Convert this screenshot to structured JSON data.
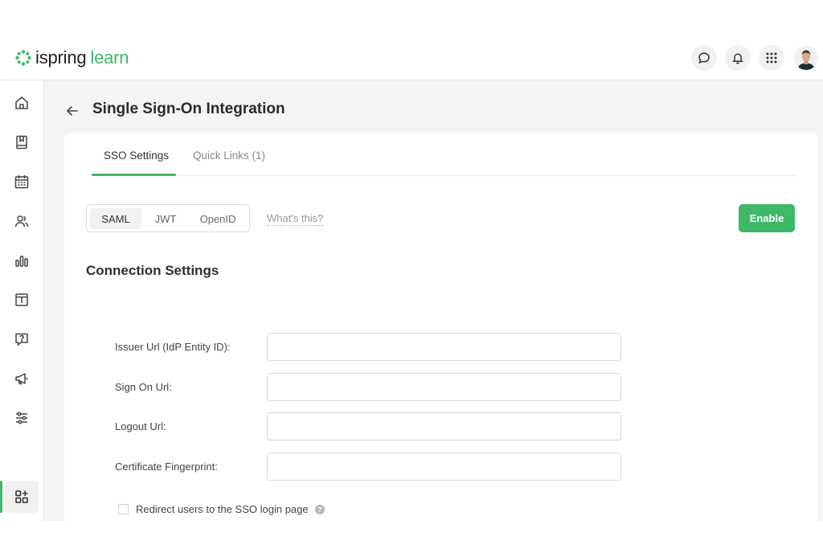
{
  "header": {
    "logo_brand": "ispring",
    "logo_product": "learn",
    "icons": [
      "chat-icon",
      "bell-icon",
      "apps-grid-icon",
      "user-avatar"
    ]
  },
  "sidebar": {
    "items": [
      {
        "name": "home-icon"
      },
      {
        "name": "book-icon"
      },
      {
        "name": "calendar-icon"
      },
      {
        "name": "users-icon"
      },
      {
        "name": "reports-icon"
      },
      {
        "name": "info-box-icon"
      },
      {
        "name": "question-icon"
      },
      {
        "name": "megaphone-icon"
      },
      {
        "name": "settings-sliders-icon"
      },
      {
        "name": "apps-add-icon",
        "active": true
      }
    ]
  },
  "page": {
    "title": "Single Sign-On Integration"
  },
  "tabs": [
    {
      "label": "SSO Settings",
      "active": true
    },
    {
      "label": "Quick Links (1)",
      "active": false
    }
  ],
  "protocols": [
    {
      "label": "SAML",
      "selected": true
    },
    {
      "label": "JWT",
      "selected": false
    },
    {
      "label": "OpenID",
      "selected": false
    }
  ],
  "whats_this": "What's this?",
  "enable_label": "Enable",
  "connection": {
    "title": "Connection Settings",
    "fields": [
      {
        "label": "Issuer Url (IdP Entity ID):",
        "value": ""
      },
      {
        "label": "Sign On Url:",
        "value": ""
      },
      {
        "label": "Logout Url:",
        "value": ""
      },
      {
        "label": "Certificate Fingerprint:",
        "value": ""
      }
    ],
    "redirect_label": "Redirect users to the SSO login page",
    "redirect_checked": false
  },
  "colors": {
    "accent": "#3fb86a",
    "background": "#f4f4f4",
    "text": "#333333"
  }
}
